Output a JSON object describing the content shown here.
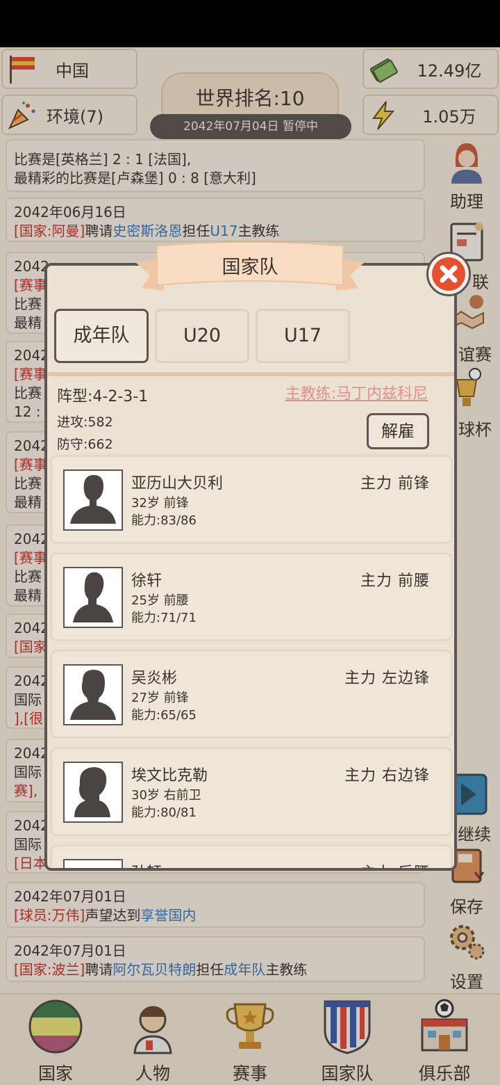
{
  "header": {
    "country": "中国",
    "environment": "环境(7)",
    "money": "12.49亿",
    "energy": "1.05万",
    "world_rank": "世界排名:10",
    "date_status": "2042年07月04日 暂停中"
  },
  "feed": [
    {
      "lines": [
        "比赛是[英格兰] 2 : 1 [法国],",
        "最精彩的比赛是[卢森堡] 0 : 8 [意大利]"
      ]
    },
    {
      "date": "2042年06月16日",
      "tag": "[国家:阿曼]",
      "verb": "聘请",
      "person": "史密斯洛恩",
      "mid": "担任",
      "team": "U17",
      "tail": "主教练"
    },
    {
      "date": "2042",
      "frag": [
        "[赛事",
        "比赛",
        "最精"
      ]
    },
    {
      "date": "2042",
      "frag": [
        "[赛事",
        "比赛",
        "12 :"
      ]
    },
    {
      "date": "2042",
      "frag": [
        "[赛事",
        "比赛",
        "最精"
      ]
    },
    {
      "date": "2042",
      "frag": [
        "[赛事",
        "比赛",
        "最精"
      ]
    },
    {
      "date": "2042",
      "frag": [
        "[国家"
      ]
    },
    {
      "date": "2042",
      "frag": [
        "国际",
        "],[很"
      ]
    },
    {
      "date": "2042",
      "frag": [
        "国际",
        "赛],"
      ]
    },
    {
      "date": "2042",
      "frag": [
        "国际",
        "[日本"
      ]
    },
    {
      "date": "2042年07月01日",
      "tag": "[球员:万伟]",
      "verb": "声望达到",
      "person": "享誉国内"
    },
    {
      "date": "2042年07月01日",
      "tag": "[国家:波兰]",
      "verb": "聘请",
      "person": "阿尔瓦贝特朗",
      "mid": "担任",
      "team": "成年队",
      "tail": "主教练"
    }
  ],
  "right_menu": {
    "assistant": "助理",
    "league_fragment": "联",
    "friendly_fragment": "谊赛",
    "cup_fragment": "球杯",
    "continue_fragment": "继续",
    "save": "保存",
    "settings": "设置"
  },
  "bottom_nav": [
    "国家",
    "人物",
    "赛事",
    "国家队",
    "俱乐部"
  ],
  "dialog": {
    "title": "国家队",
    "tabs": [
      "成年队",
      "U20",
      "U17"
    ],
    "active_tab": 0,
    "formation": "阵型:4-2-3-1",
    "attack": "进攻:582",
    "defense": "防守:662",
    "coach": "主教练:马丁内兹科尼",
    "fire_button": "解雇",
    "players": [
      {
        "name": "亚历山大贝利",
        "info": "32岁 前锋",
        "ability": "能力:83/86",
        "role": "主力 前锋"
      },
      {
        "name": "徐轩",
        "info": "25岁 前腰",
        "ability": "能力:71/71",
        "role": "主力 前腰"
      },
      {
        "name": "吴炎彬",
        "info": "27岁 前锋",
        "ability": "能力:65/65",
        "role": "主力 左边锋"
      },
      {
        "name": "埃文比克勒",
        "info": "30岁 右前卫",
        "ability": "能力:80/81",
        "role": "主力 右边锋"
      },
      {
        "name": "孙轩",
        "info": "",
        "ability": "",
        "role": "主力 后腰"
      }
    ]
  },
  "colors": {
    "accent_red": "#c8302c",
    "accent_blue": "#3977b8",
    "coach_pink": "#e08f8c",
    "close_orange": "#e5512e",
    "bg": "#f1e8da"
  }
}
